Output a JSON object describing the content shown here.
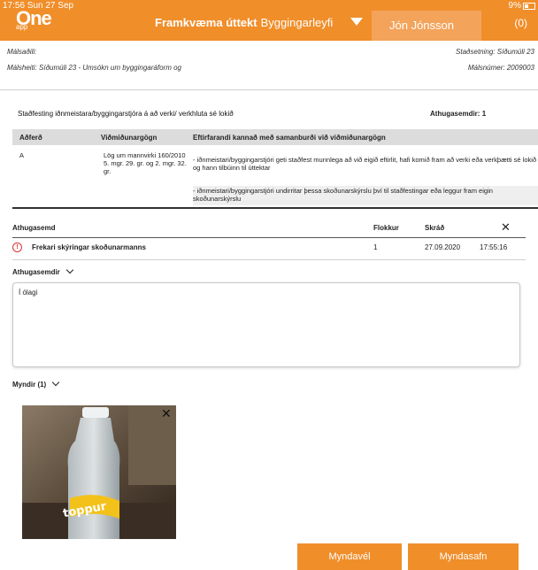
{
  "status": {
    "time": "17:56  Sun 27 Sep",
    "battery": "9%"
  },
  "header": {
    "logo_main": "One",
    "logo_sub": "app",
    "title": "Framkvæma úttekt",
    "subtitle": "Byggingarleyfi",
    "user": "Jón Jónsson",
    "count": "(0)"
  },
  "case": {
    "malsadili_label": "Málsaðili:",
    "malsheiti": "Málsheiti:  Síðumúli 23 - Umsókn um byggingaráform og",
    "stadsetning": "Staðsetning:  Síðumúli 23",
    "malsnumer": "Málsnúmer:  2009003"
  },
  "section": {
    "title": "Staðfesting iðnmeistara/byggingarstjóra á að verki/ verkhluta sé lokið",
    "athugasemdir_label": "Athugasemdir:",
    "athugasemdir_count": "1"
  },
  "table": {
    "headers": [
      "Aðferð",
      "Viðmiðunargögn",
      "Eftirfarandi kannað með samanburði við viðmiðunargögn"
    ],
    "row": {
      "method": "A",
      "reference": "Lög um mannvirki 160/2010 5. mgr. 29. gr. og 2. mgr. 32. gr.",
      "criteria": [
        "- iðnmeistari/byggingarstjóri geti staðfest munnlega að við eigið eftirlit, hafi komið fram að verki eða verkþætti sé lokið og hann tilbúinn til úttektar",
        "- iðnmeistari/byggingarstjóri undirritar þessa skoðunarskýrslu því til staðfestingar eða leggur fram eigin skoðunarskýrslu"
      ]
    }
  },
  "remarks": {
    "headers": {
      "athugasemd": "Athugasemd",
      "flokkur": "Flokkur",
      "skrad": "Skráð"
    },
    "close": "✕",
    "row": {
      "text": "Frekari skýringar skoðunarmanns",
      "flokkur": "1",
      "date": "27.09.2020",
      "time": "17:55:16"
    }
  },
  "comments": {
    "label": "Athugasemdir",
    "value": "Í ólagi"
  },
  "images": {
    "label": "Myndir  (1)",
    "photo_label": "toppur",
    "photo_close": "✕"
  },
  "buttons": {
    "camera": "Myndavél",
    "gallery": "Myndasafn"
  },
  "colors": {
    "accent": "#f08e2a",
    "user_box": "#f4a35a",
    "warning": "#d33333"
  }
}
